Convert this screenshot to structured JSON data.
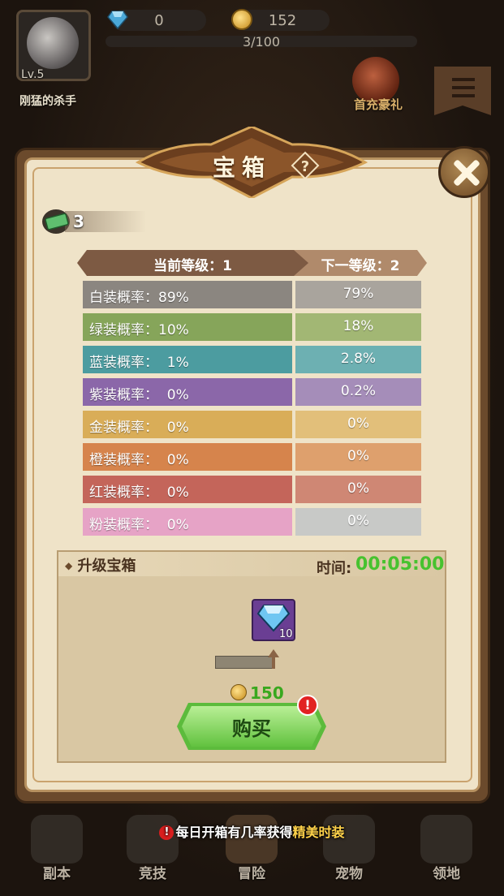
{
  "player": {
    "level": "Lv.5",
    "name": "刚猛的杀手"
  },
  "resources": {
    "gems": "0",
    "coins": "152",
    "xp": "3/100"
  },
  "promo": {
    "label": "首充豪礼"
  },
  "dialog": {
    "title": "宝箱",
    "ticket_count": "3",
    "current_level_label": "当前等级：1",
    "next_level_label": "下一等级：2",
    "rows": [
      {
        "label": "白装概率：89%",
        "next": "79%",
        "color_left": "#8b8680",
        "color_right": "#a9a49d"
      },
      {
        "label": "绿装概率：10%",
        "next": "18%",
        "color_left": "#86a55a",
        "color_right": "#a2b774"
      },
      {
        "label": "蓝装概率：  1%",
        "next": "2.8%",
        "color_left": "#4c9ca0",
        "color_right": "#6db0b2"
      },
      {
        "label": "紫装概率：  0%",
        "next": "0.2%",
        "color_left": "#8b67a9",
        "color_right": "#a58db9"
      },
      {
        "label": "金装概率：  0%",
        "next": "0%",
        "color_left": "#d9ad58",
        "color_right": "#e2bf7a"
      },
      {
        "label": "橙装概率：  0%",
        "next": "0%",
        "color_left": "#d6844c",
        "color_right": "#dea06d"
      },
      {
        "label": "红装概率：  0%",
        "next": "0%",
        "color_left": "#c4655a",
        "color_right": "#cf8774"
      },
      {
        "label": "粉装概率：  0%",
        "next": "0%",
        "color_left": "#e6a3c6",
        "color_right": "#c8c9c7"
      }
    ],
    "upgrade": {
      "title": "升级宝箱",
      "time_label": "时间:",
      "time_value": "00:05:00",
      "gem_cost": "10",
      "coin_price": "150",
      "buy_label": "购买",
      "badge": "!"
    }
  },
  "notice": {
    "prefix": "每日开箱有几率获得",
    "highlight": "精美时装",
    "badge": "!"
  },
  "nav": [
    "副本",
    "竞技",
    "冒险",
    "宠物",
    "领地"
  ]
}
